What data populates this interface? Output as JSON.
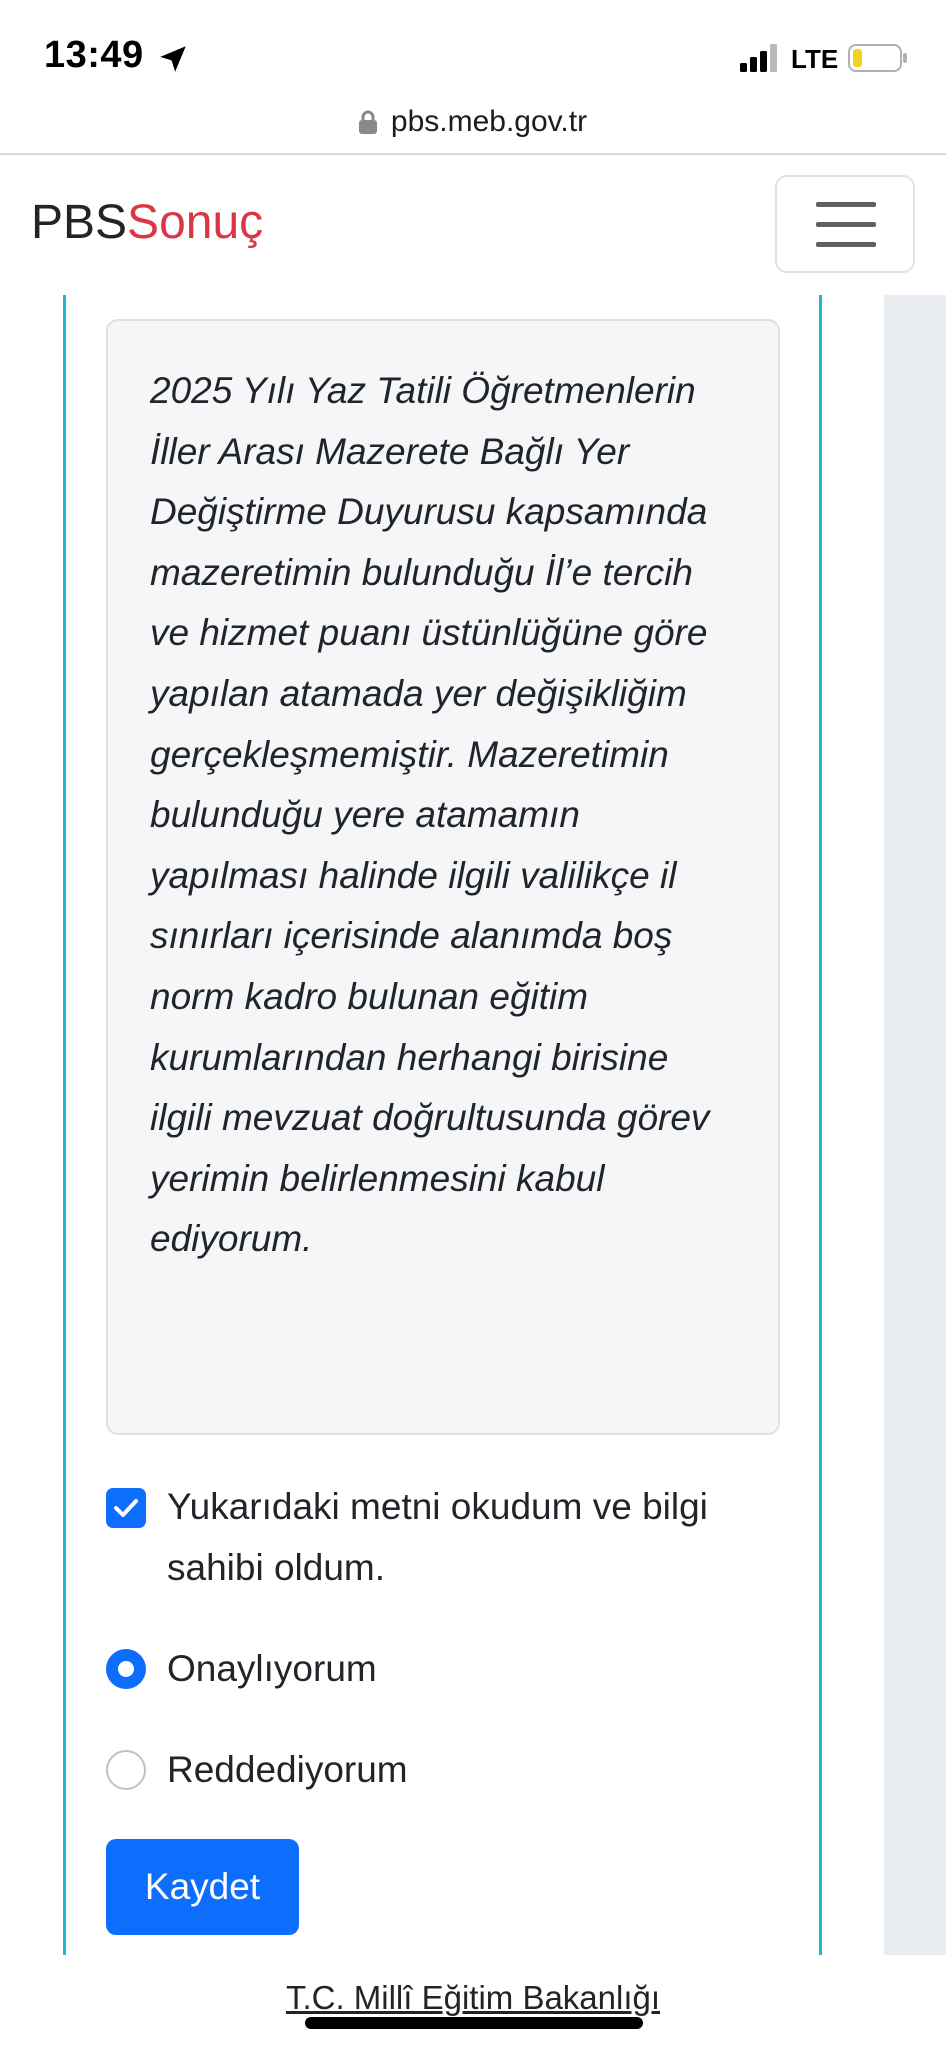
{
  "status_bar": {
    "time": "13:49",
    "network": "LTE",
    "icons": [
      "location-arrow-icon",
      "signal-icon",
      "battery-icon"
    ],
    "battery_color": "#f5d31c"
  },
  "browser": {
    "url": "pbs.meb.gov.tr"
  },
  "navbar": {
    "brand_prefix": "PBS",
    "brand_suffix": "Sonuç",
    "brand_accent_color": "#dc3545"
  },
  "declaration": {
    "text": "2025 Yılı Yaz Tatili Öğretmenlerin İller Arası Mazerete Bağlı Yer Değiştirme Duyurusu kapsamında mazeretimin bulunduğu İl’e tercih ve hizmet puanı üstünlüğüne göre yapılan atamada yer değişikliğim gerçekleşmemiştir. Mazeretimin bulunduğu yere atamamın yapılması halinde ilgili valilikçe il sınırları içerisinde alanımda boş norm kadro bulunan eğitim kurumlarından herhangi birisine ilgili mevzuat doğrultusunda görev yerimin belirlenmesini kabul ediyorum."
  },
  "form": {
    "acknowledge_label": "Yukarıdaki metni okudum ve bilgi sahibi oldum.",
    "acknowledge_checked": true,
    "options": [
      {
        "label": "Onaylıyorum",
        "selected": true
      },
      {
        "label": "Reddediyorum",
        "selected": false
      }
    ],
    "save_label": "Kaydet",
    "primary_color": "#0d6efd"
  },
  "footer": {
    "text": "T.C. Millî Eğitim Bakanlığı"
  }
}
